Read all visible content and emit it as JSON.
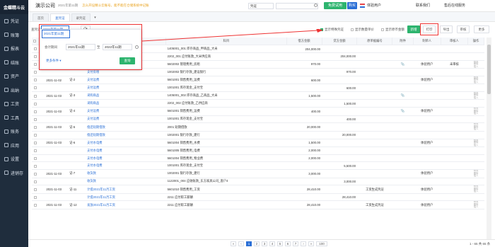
{
  "sidebar": {
    "logo": "金蝶精斗云",
    "items": [
      {
        "label": "凭证",
        "icon": "voucher-icon"
      },
      {
        "label": "账簿",
        "icon": "ledger-icon"
      },
      {
        "label": "报表",
        "icon": "report-icon"
      },
      {
        "label": "结账",
        "icon": "close-account-icon"
      },
      {
        "label": "资产",
        "icon": "asset-icon"
      },
      {
        "label": "出纳",
        "icon": "cashier-icon"
      },
      {
        "label": "工资",
        "icon": "salary-icon"
      },
      {
        "label": "工具",
        "icon": "tool-icon"
      },
      {
        "label": "账务",
        "icon": "accounting-icon"
      },
      {
        "label": "应用",
        "icon": "app-icon"
      },
      {
        "label": "设置",
        "icon": "settings-icon"
      },
      {
        "label": "进销存",
        "icon": "inventory-icon"
      }
    ]
  },
  "topbar": {
    "company": "演示公司",
    "period": "2021年第11期",
    "promo": "怎么开设精斗云账号，能不能在仓储系统中记账",
    "search_scope": "凭证",
    "free_trial": "免费试用",
    "buy": "购买",
    "user": "体验用户",
    "contact": "联系我们",
    "online": "售后在线服务"
  },
  "tabs": [
    "首页",
    "查凭证",
    "录凭证"
  ],
  "toolbar": {
    "date_label": "查凭证",
    "date_value": "2021年第11期",
    "show_special": "显示特殊凭证",
    "show_amount": "显示数量单价",
    "show_foreign": "显示原币金额",
    "batch": "新增",
    "print": "打印",
    "export": "导出",
    "audit": "审核",
    "more": "更多"
  },
  "panel": {
    "period_label": "会计期间",
    "from": "2021年11期",
    "to": "2022年11期",
    "more": "更多条件",
    "query": "查询"
  },
  "table": {
    "headers": [
      "",
      "日期",
      "凭证字号",
      "摘要",
      "科目",
      "借方金额",
      "贷方金额",
      "原单据编号",
      "附件",
      "制单人",
      "审核人",
      "操作"
    ],
    "rows": [
      [
        "",
        "",
        "",
        "",
        "1405001_001 库存商品_甲商品_大米",
        "204,000.00",
        "",
        "",
        "",
        "",
        "",
        ""
      ],
      [
        "",
        "",
        "",
        "",
        "2202_001 应付账款_大米供应商",
        "",
        "204,000.00",
        "",
        "",
        "",
        "",
        ""
      ],
      [
        "",
        "2021-11-01",
        "记-46",
        "支付房租",
        "5602002 管理费用_房租",
        "970.00",
        "",
        "",
        "attach",
        "体验用户",
        "未审核",
        ""
      ],
      [
        "",
        "",
        "",
        "支付房租",
        "1002002 银行存款_建设银行",
        "",
        "970.00",
        "",
        "",
        "",
        "",
        ""
      ],
      [
        "",
        "2021-11-02",
        "记-2",
        "支付运费",
        "5601001 销售费用_运费",
        "600.00",
        "",
        "",
        "",
        "体验用户",
        "",
        ""
      ],
      [
        "",
        "",
        "",
        "支付运费",
        "1001001 库存现金_支付宝",
        "",
        "600.00",
        "",
        "",
        "",
        "",
        ""
      ],
      [
        "",
        "2021-11-03",
        "记-3",
        "采购商品",
        "1405001_002 库存商品_乙商品_大米",
        "1,500.00",
        "",
        "",
        "attach",
        "",
        "",
        ""
      ],
      [
        "",
        "",
        "",
        "采购商品",
        "2202_002 应付账款_乙供应商",
        "",
        "1,500.00",
        "",
        "",
        "",
        "",
        ""
      ],
      [
        "",
        "2021-11-03",
        "记-4",
        "支付运费",
        "5601001 销售费用_运费",
        "400.00",
        "",
        "",
        "attach",
        "体验用户",
        "",
        ""
      ],
      [
        "",
        "",
        "",
        "支付运费",
        "1001001 库存现金_支付宝",
        "",
        "400.00",
        "",
        "",
        "",
        "",
        ""
      ],
      [
        "",
        "2021-11-03",
        "记-5",
        "偿还短期借款",
        "2001 短期借款",
        "20,000.00",
        "",
        "",
        "",
        "",
        "",
        ""
      ],
      [
        "",
        "",
        "",
        "偿还短期借款",
        "1002001 银行存款_建行",
        "",
        "20,000.00",
        "",
        "",
        "",
        "",
        ""
      ],
      [
        "",
        "2021-11-03",
        "记-6",
        "支付水电费",
        "5601004 销售费用_水费",
        "1,500.00",
        "",
        "",
        "",
        "体验用户",
        "",
        ""
      ],
      [
        "",
        "",
        "",
        "支付水电费",
        "5601005 销售费用_电费",
        "2,000.00",
        "",
        "",
        "",
        "",
        "",
        ""
      ],
      [
        "",
        "",
        "",
        "支付水电费",
        "5601004 销售费用_物业费",
        "2,000.00",
        "",
        "",
        "",
        "",
        "",
        ""
      ],
      [
        "",
        "",
        "",
        "支付水电费",
        "1001001 库存现金_支付宝",
        "",
        "5,500.00",
        "",
        "",
        "",
        "",
        ""
      ],
      [
        "",
        "2021-11-03",
        "记-7",
        "收货款",
        "1002001 银行存款_建行",
        "3,000.00",
        "",
        "",
        "",
        "体验用户",
        "",
        ""
      ],
      [
        "",
        "",
        "",
        "收货款",
        "1122001_004 应收账款_东方家具公司_客户4",
        "",
        "3,000.00",
        "",
        "",
        "",
        "",
        ""
      ],
      [
        "",
        "2021-11-03",
        "记-11",
        "计提2021年11月工资",
        "5601010 销售费用_工资",
        "28,410.00",
        "",
        "工资生成凭证",
        "",
        "体验用户",
        "",
        ""
      ],
      [
        "",
        "",
        "",
        "计提2021年11月工资",
        "2211 应付职工薪酬",
        "",
        "28,410.00",
        "",
        "",
        "",
        "",
        ""
      ],
      [
        "",
        "2021-11-03",
        "记-12",
        "发放2021年11月工资",
        "2211 应付职工薪酬",
        "28,410.00",
        "",
        "工资生成凭证",
        "",
        "体验用户",
        "",
        ""
      ]
    ],
    "ops": [
      "修改",
      "删除",
      "插入"
    ]
  },
  "footer": {
    "pages": [
      "1",
      "2",
      "3",
      "4",
      "5",
      "6",
      "7"
    ],
    "page_size": "100",
    "info": "1 - 65 共 65 条"
  }
}
